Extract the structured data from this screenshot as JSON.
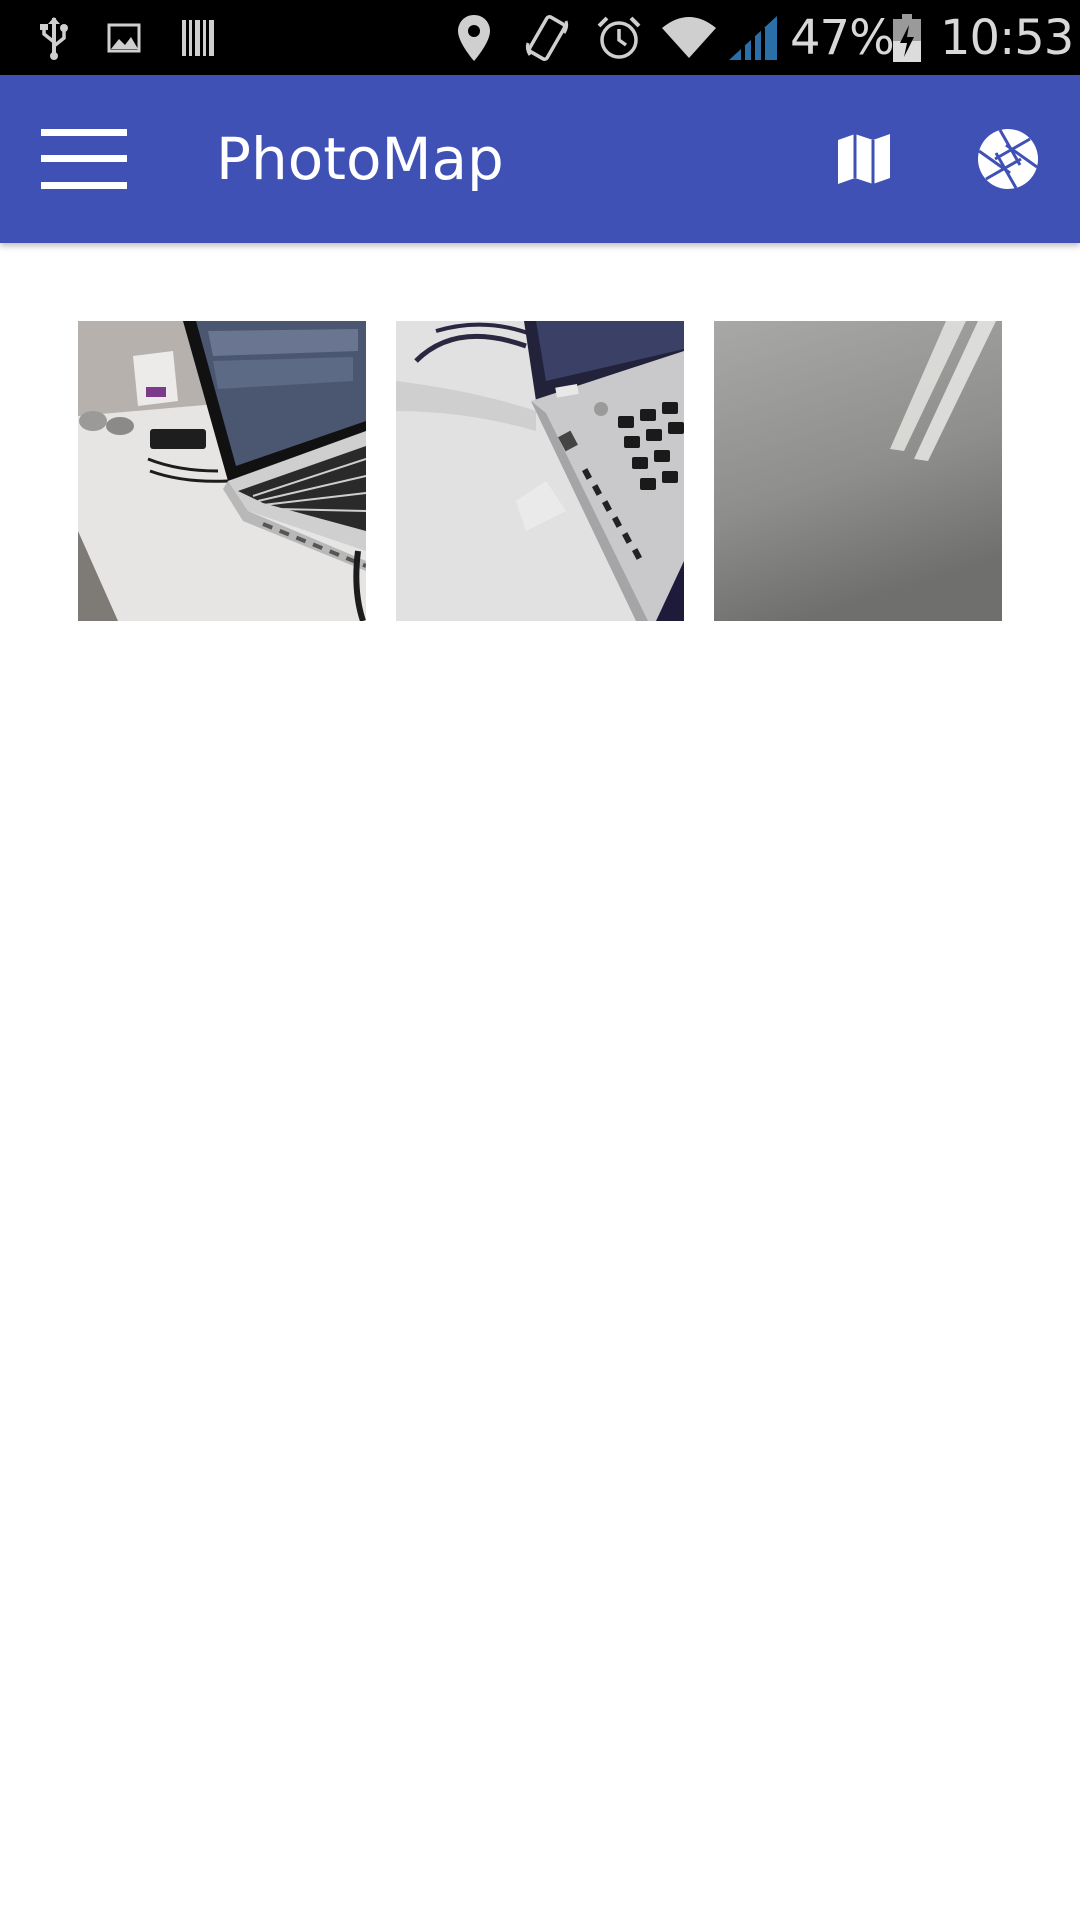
{
  "status_bar": {
    "battery": "47%",
    "time": "10:53",
    "icons": [
      "usb-icon",
      "image-icon",
      "barcode-icon",
      "location-icon",
      "vibrate-icon",
      "alarm-icon",
      "wifi-icon",
      "signal-icon",
      "battery-icon"
    ]
  },
  "app_bar": {
    "title": "PhotoMap",
    "color": "#3f51b5",
    "menu_icon": "hamburger-menu-icon",
    "actions": [
      "map-icon",
      "camera-aperture-icon"
    ]
  },
  "photos": [
    {
      "description_icon": "photo-laptop-desk"
    },
    {
      "description_icon": "photo-laptop-closeup"
    },
    {
      "description_icon": "photo-grey-surface"
    }
  ]
}
